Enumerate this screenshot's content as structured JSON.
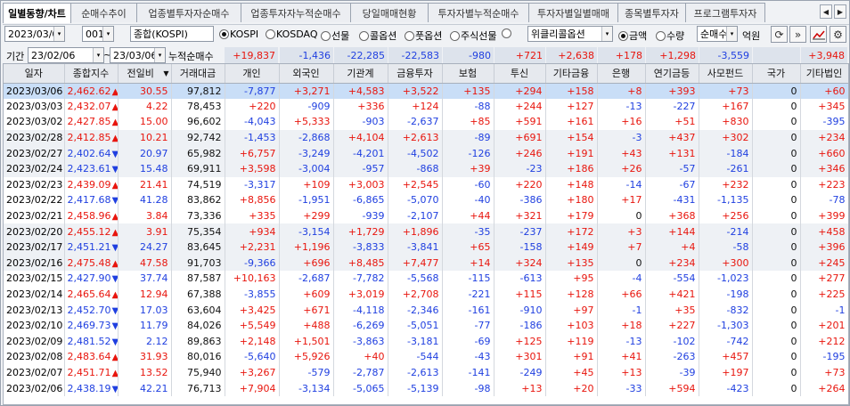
{
  "tabs": [
    "일별동향/차트",
    "순매수추이",
    "업종별투자자순매수",
    "업종투자자누적순매수",
    "당일매매현황",
    "투자자별누적순매수",
    "투자자별일별매매",
    "종목별투자자",
    "프로그램투자자"
  ],
  "toolbar": {
    "date": "2023/03/06",
    "market_code": "001",
    "market_name": "종합(KOSPI)",
    "radios_market": [
      {
        "label": "KOSPI",
        "on": true
      },
      {
        "label": "KOSDAQ",
        "on": false
      },
      {
        "label": "선물",
        "on": false
      },
      {
        "label": "콜옵션",
        "on": false
      },
      {
        "label": "풋옵션",
        "on": false
      },
      {
        "label": "주식선물",
        "on": false
      },
      {
        "label": "위클리콜옵션",
        "on": false
      }
    ],
    "weekly_option": "위클리콜옵션",
    "radios_unit": [
      {
        "label": "금액",
        "on": true
      },
      {
        "label": "수량",
        "on": false
      }
    ],
    "type_select": "순매수",
    "unit_label": "억원"
  },
  "period": {
    "label": "기간",
    "from": "23/02/06",
    "to": "23/03/06",
    "tilde": "~",
    "cum_label": "누적순매수",
    "sums": [
      "+19,837",
      "-1,436",
      "-22,285",
      "-22,583",
      "-980",
      "+721",
      "+2,638",
      "+178",
      "+1,298",
      "-3,559",
      "",
      "+3,948"
    ]
  },
  "columns": [
    "일자",
    "종합지수",
    "전일비",
    "거래대금",
    "개인",
    "외국인",
    "기관계",
    "금융투자",
    "보험",
    "투신",
    "기타금융",
    "은행",
    "연기금등",
    "사모펀드",
    "국가",
    "기타법인"
  ],
  "rows": [
    [
      "2023/03/06",
      "2,462.62",
      "u",
      "30.55",
      "97,812",
      "-7,877",
      "+3,271",
      "+4,583",
      "+3,522",
      "+135",
      "+294",
      "+158",
      "+8",
      "+393",
      "+73",
      "0",
      "+60"
    ],
    [
      "2023/03/03",
      "2,432.07",
      "u",
      "4.22",
      "78,453",
      "+220",
      "-909",
      "+336",
      "+124",
      "-88",
      "+244",
      "+127",
      "-13",
      "-227",
      "+167",
      "0",
      "+345"
    ],
    [
      "2023/03/02",
      "2,427.85",
      "u",
      "15.00",
      "96,602",
      "-4,043",
      "+5,333",
      "-903",
      "-2,637",
      "+85",
      "+591",
      "+161",
      "+16",
      "+51",
      "+830",
      "0",
      "-395"
    ],
    [
      "2023/02/28",
      "2,412.85",
      "u",
      "10.21",
      "92,742",
      "-1,453",
      "-2,868",
      "+4,104",
      "+2,613",
      "-89",
      "+691",
      "+154",
      "-3",
      "+437",
      "+302",
      "0",
      "+234"
    ],
    [
      "2023/02/27",
      "2,402.64",
      "d",
      "20.97",
      "65,982",
      "+6,757",
      "-3,249",
      "-4,201",
      "-4,502",
      "-126",
      "+246",
      "+191",
      "+43",
      "+131",
      "-184",
      "0",
      "+660"
    ],
    [
      "2023/02/24",
      "2,423.61",
      "d",
      "15.48",
      "69,911",
      "+3,598",
      "-3,004",
      "-957",
      "-868",
      "+39",
      "-23",
      "+186",
      "+26",
      "-57",
      "-261",
      "0",
      "+346"
    ],
    [
      "2023/02/23",
      "2,439.09",
      "u",
      "21.41",
      "74,519",
      "-3,317",
      "+109",
      "+3,003",
      "+2,545",
      "-60",
      "+220",
      "+148",
      "-14",
      "-67",
      "+232",
      "0",
      "+223"
    ],
    [
      "2023/02/22",
      "2,417.68",
      "d",
      "41.28",
      "83,862",
      "+8,856",
      "-1,951",
      "-6,865",
      "-5,070",
      "-40",
      "-386",
      "+180",
      "+17",
      "-431",
      "-1,135",
      "0",
      "-78"
    ],
    [
      "2023/02/21",
      "2,458.96",
      "u",
      "3.84",
      "73,336",
      "+335",
      "+299",
      "-939",
      "-2,107",
      "+44",
      "+321",
      "+179",
      "0",
      "+368",
      "+256",
      "0",
      "+399"
    ],
    [
      "2023/02/20",
      "2,455.12",
      "u",
      "3.91",
      "75,354",
      "+934",
      "-3,154",
      "+1,729",
      "+1,896",
      "-35",
      "-237",
      "+172",
      "+3",
      "+144",
      "-214",
      "0",
      "+458"
    ],
    [
      "2023/02/17",
      "2,451.21",
      "d",
      "24.27",
      "83,645",
      "+2,231",
      "+1,196",
      "-3,833",
      "-3,841",
      "+65",
      "-158",
      "+149",
      "+7",
      "+4",
      "-58",
      "0",
      "+396"
    ],
    [
      "2023/02/16",
      "2,475.48",
      "u",
      "47.58",
      "91,703",
      "-9,366",
      "+696",
      "+8,485",
      "+7,477",
      "+14",
      "+324",
      "+135",
      "0",
      "+234",
      "+300",
      "0",
      "+245"
    ],
    [
      "2023/02/15",
      "2,427.90",
      "d",
      "37.74",
      "87,587",
      "+10,163",
      "-2,687",
      "-7,782",
      "-5,568",
      "-115",
      "-613",
      "+95",
      "-4",
      "-554",
      "-1,023",
      "0",
      "+277"
    ],
    [
      "2023/02/14",
      "2,465.64",
      "u",
      "12.94",
      "67,388",
      "-3,855",
      "+609",
      "+3,019",
      "+2,708",
      "-221",
      "+115",
      "+128",
      "+66",
      "+421",
      "-198",
      "0",
      "+225"
    ],
    [
      "2023/02/13",
      "2,452.70",
      "d",
      "17.03",
      "63,604",
      "+3,425",
      "+671",
      "-4,118",
      "-2,346",
      "-161",
      "-910",
      "+97",
      "-1",
      "+35",
      "-832",
      "0",
      "-1"
    ],
    [
      "2023/02/10",
      "2,469.73",
      "d",
      "11.79",
      "84,026",
      "+5,549",
      "+488",
      "-6,269",
      "-5,051",
      "-77",
      "-186",
      "+103",
      "+18",
      "+227",
      "-1,303",
      "0",
      "+201"
    ],
    [
      "2023/02/09",
      "2,481.52",
      "d",
      "2.12",
      "89,863",
      "+2,148",
      "+1,501",
      "-3,863",
      "-3,181",
      "-69",
      "+125",
      "+119",
      "-13",
      "-102",
      "-742",
      "0",
      "+212"
    ],
    [
      "2023/02/08",
      "2,483.64",
      "u",
      "31.93",
      "80,016",
      "-5,640",
      "+5,926",
      "+40",
      "-544",
      "-43",
      "+301",
      "+91",
      "+41",
      "-263",
      "+457",
      "0",
      "-195"
    ],
    [
      "2023/02/07",
      "2,451.71",
      "u",
      "13.52",
      "75,940",
      "+3,267",
      "-579",
      "-2,787",
      "-2,613",
      "-141",
      "-249",
      "+45",
      "+13",
      "-39",
      "+197",
      "0",
      "+73"
    ],
    [
      "2023/02/06",
      "2,438.19",
      "d",
      "42.21",
      "76,713",
      "+7,904",
      "-3,134",
      "-5,065",
      "-5,139",
      "-98",
      "+13",
      "+20",
      "-33",
      "+594",
      "-423",
      "0",
      "+264"
    ]
  ],
  "colors": {
    "up": "#e8150d",
    "down": "#1f3fe0",
    "selected_row": "#c9def7",
    "header": "#e6e9ee",
    "sum_bar": "#dde3ec"
  }
}
